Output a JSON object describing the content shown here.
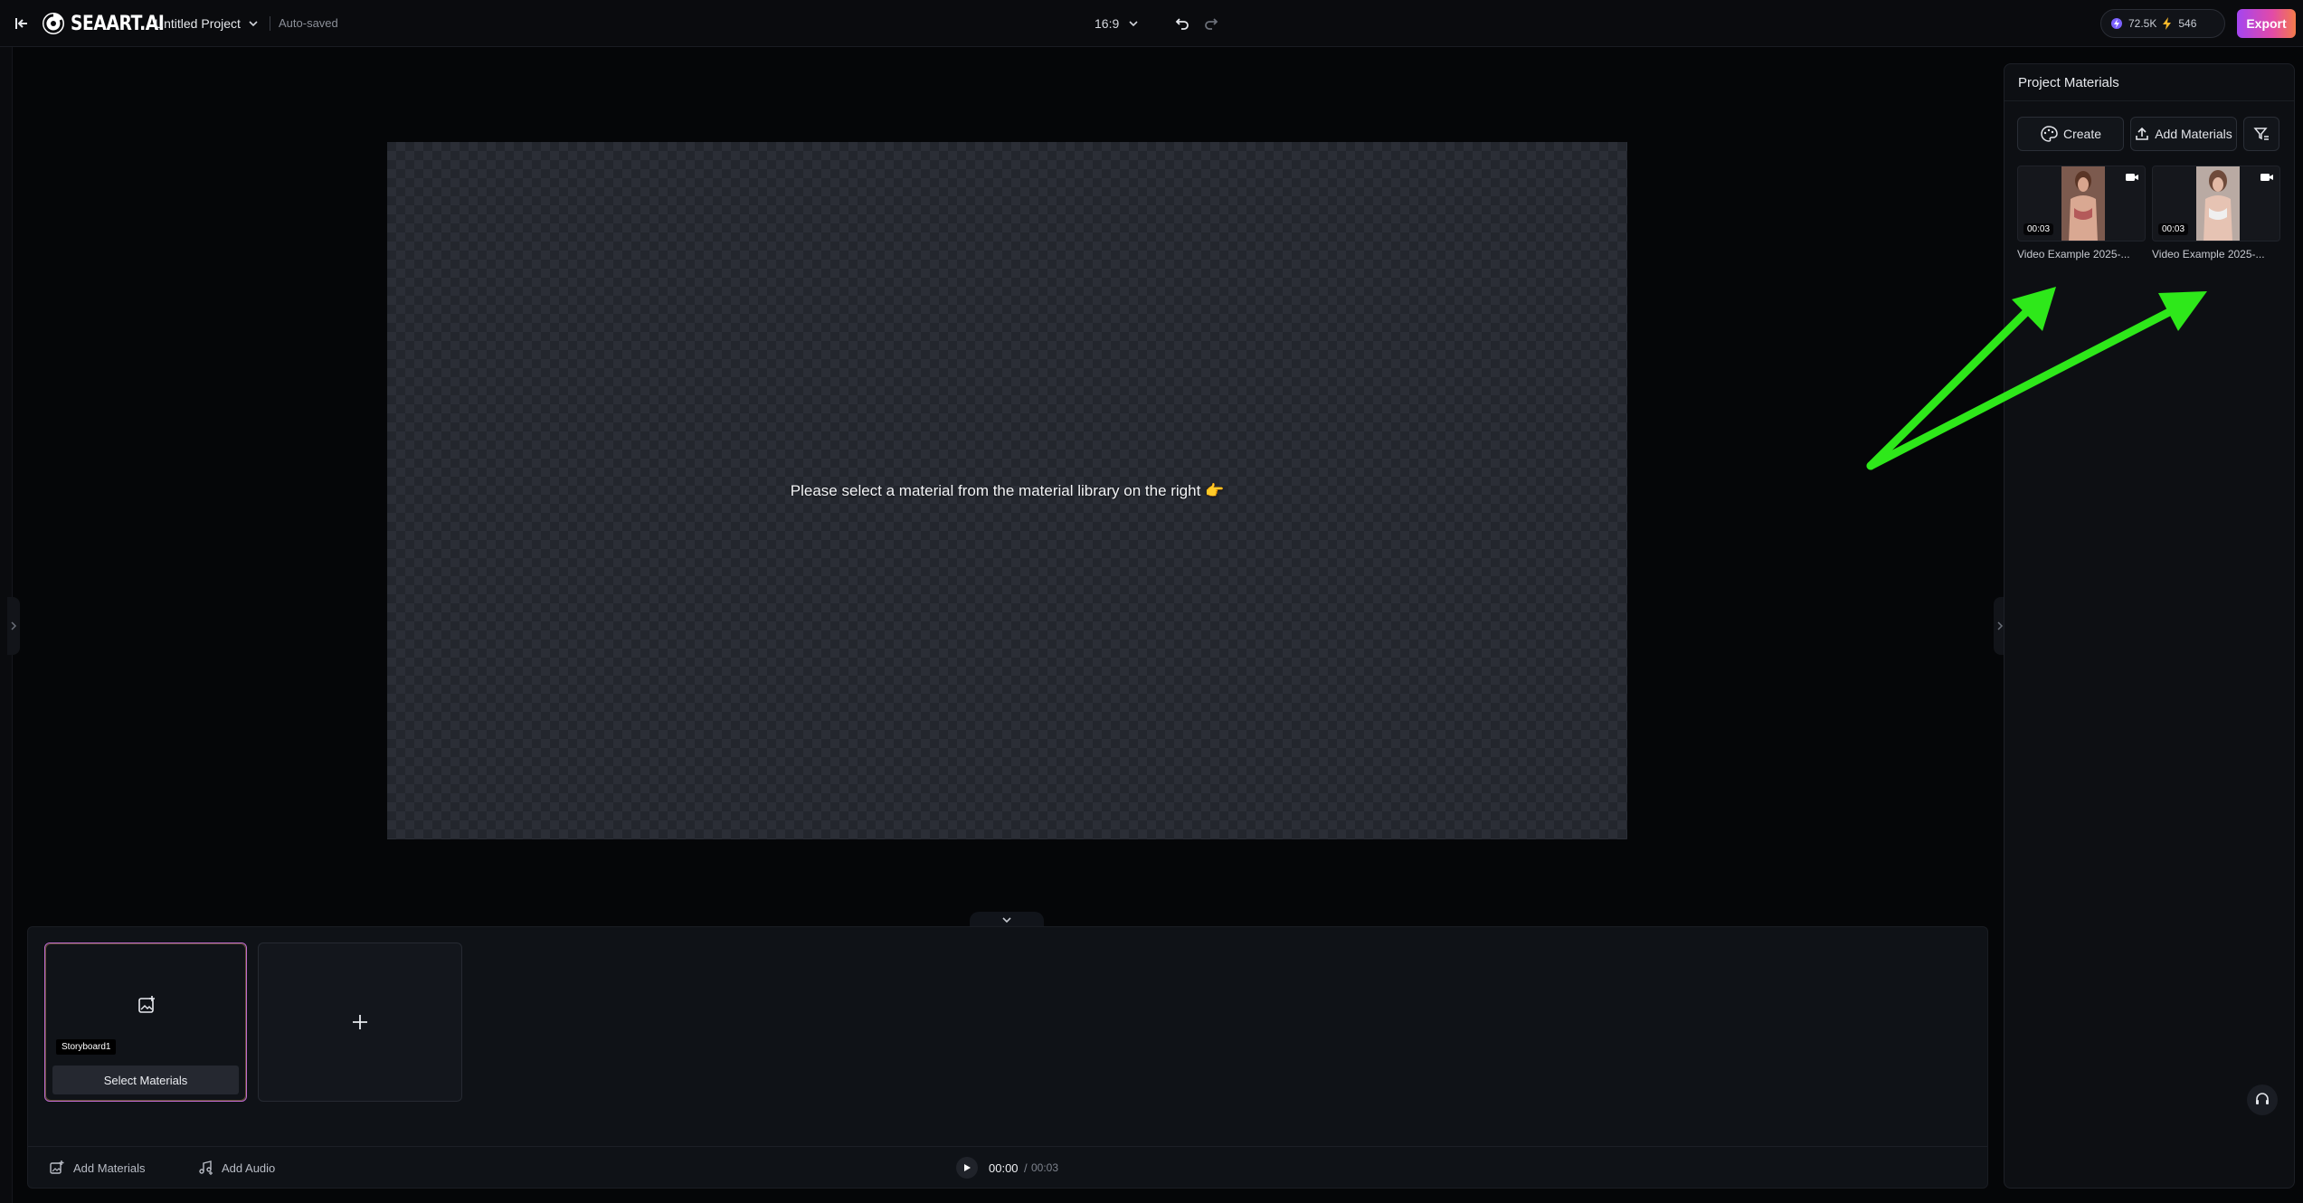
{
  "header": {
    "logo_text": "SEAART.AI",
    "project_title": "Untitled Project",
    "save_status": "Auto-saved",
    "aspect_ratio": "16:9",
    "credits_a": "72.5K",
    "credits_b": "546",
    "export_label": "Export"
  },
  "canvas": {
    "message": "Please select a material from the material library on the right 👉"
  },
  "panel": {
    "title": "Project Materials",
    "create_label": "Create",
    "add_materials_label": "Add Materials",
    "materials": [
      {
        "name": "Video Example 2025-...",
        "duration": "00:03"
      },
      {
        "name": "Video Example 2025-...",
        "duration": "00:03"
      }
    ]
  },
  "storyboard": {
    "card_label": "Storyboard1",
    "select_materials_label": "Select Materials"
  },
  "bottom_bar": {
    "add_materials_label": "Add Materials",
    "add_audio_label": "Add Audio",
    "time_current": "00:00",
    "time_separator": "/",
    "time_total": "00:03"
  },
  "colors": {
    "accent_start": "#a445f0",
    "accent_end": "#f37a4b",
    "arrow_green": "#2ee81a"
  }
}
